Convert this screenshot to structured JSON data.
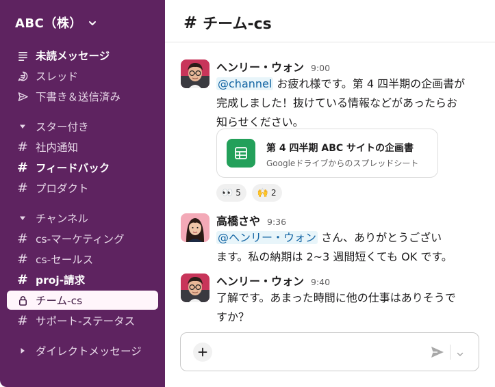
{
  "workspace": {
    "name": "ABC（株）"
  },
  "sidebar": {
    "top_items": [
      {
        "label": "未読メッセージ",
        "icon": "unread-list-icon",
        "bold": true
      },
      {
        "label": "スレッド",
        "icon": "threads-icon"
      },
      {
        "label": "下書き＆送信済み",
        "icon": "send-icon"
      }
    ],
    "starred_section": "スター付き",
    "starred": [
      {
        "label": "社内通知"
      },
      {
        "label": "フィードバック",
        "bold": true
      },
      {
        "label": "プロダクト"
      }
    ],
    "channels_section": "チャンネル",
    "channels": [
      {
        "label": "cs-マーケティング"
      },
      {
        "label": "cs-セールス"
      },
      {
        "label": "proj-請求",
        "bold": true
      },
      {
        "label": "チーム-cs",
        "active": true,
        "icon": "lock-icon"
      },
      {
        "label": "サポート-ステータス"
      }
    ],
    "dm_section": "ダイレクトメッセージ"
  },
  "channel": {
    "hash": "#",
    "name": "チーム-cs"
  },
  "messages": [
    {
      "author": "ヘンリー・ウォン",
      "time": "9:00",
      "mention": "@channel",
      "line1": " お疲れ様です。第 4 四半期の企画書が",
      "line2": "完成しました！抜けている情報などがあったらお",
      "line3": "知らせください。",
      "attachment": {
        "title": "第 4 四半期 ABC サイトの企画書",
        "subtitle": "Googleドライブからのスプレッドシート"
      },
      "reactions": [
        {
          "emoji": "👀",
          "count": "5"
        },
        {
          "emoji": "🙌",
          "count": "2"
        }
      ]
    },
    {
      "author": "高橋さや",
      "time": "9:36",
      "mention": "@ヘンリー・ウォン",
      "line1": " さん、ありがとうござい",
      "line2": "ます。私の納期は 2~3 週間短くても OK です。"
    },
    {
      "author": "ヘンリー・ウォン",
      "time": "9:40",
      "line1": "了解です。あまった時間に他の仕事はありそうで",
      "line2": "すか？"
    }
  ],
  "colors": {
    "sidebar_bg": "#5e2360",
    "active_item_bg": "#fff5fb",
    "mention_bg": "#e8f5fa",
    "mention_text": "#1264a3",
    "sheet_green": "#23a05a"
  }
}
